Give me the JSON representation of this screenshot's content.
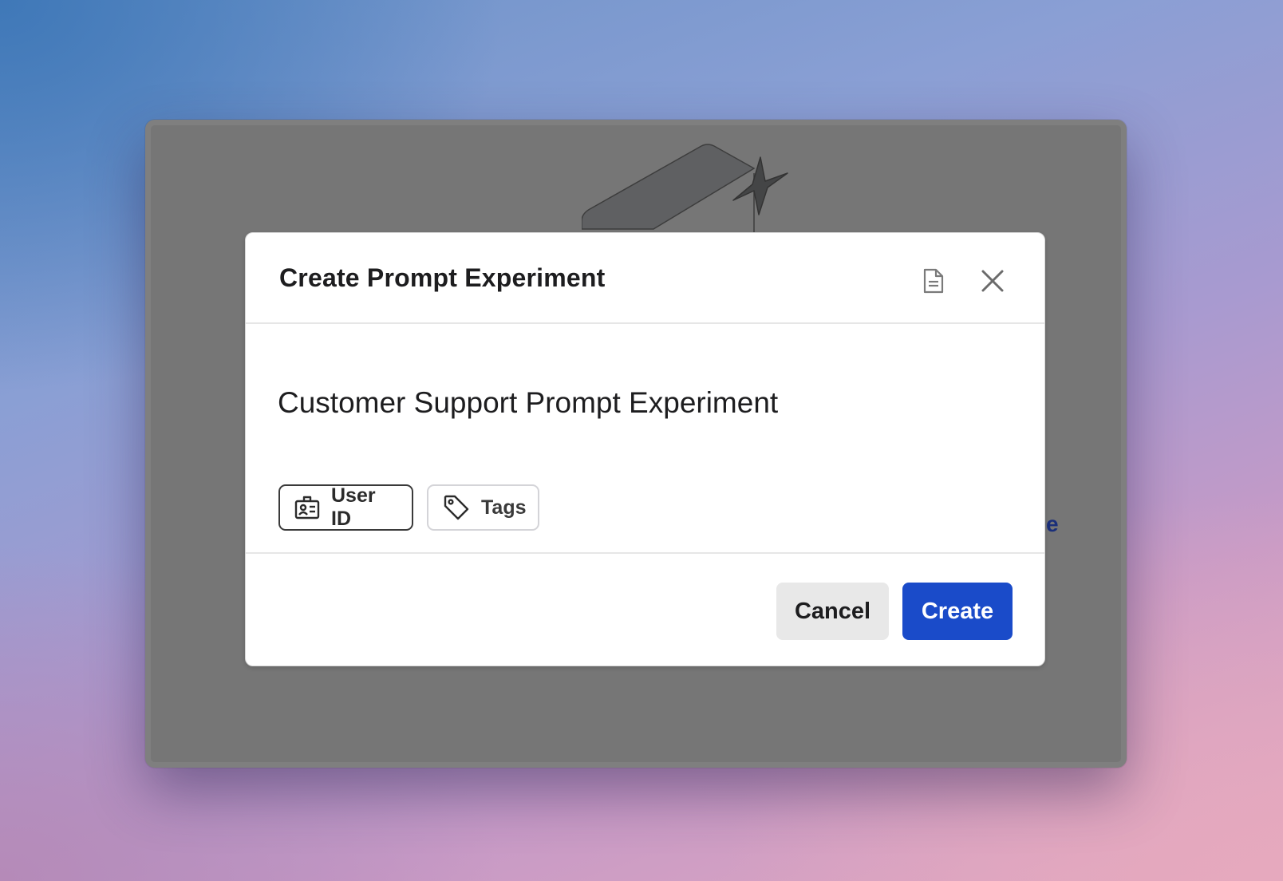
{
  "background_window": {
    "link_fragment": "e"
  },
  "modal": {
    "title": "Create Prompt Experiment",
    "doc_icon": "document-icon",
    "close_icon": "close-icon",
    "name_value": "Customer Support Prompt Experiment",
    "chips": [
      {
        "label": "User ID",
        "icon": "user-id-badge-icon"
      },
      {
        "label": "Tags",
        "icon": "tag-icon"
      }
    ],
    "cancel_label": "Cancel",
    "create_label": "Create"
  },
  "colors": {
    "primary": "#1a4bc9",
    "overlay": "#767676"
  }
}
